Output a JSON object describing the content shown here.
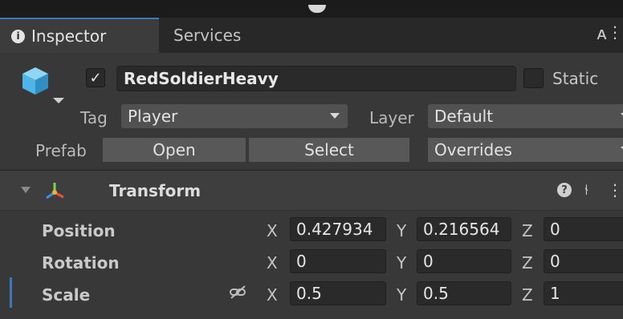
{
  "tabs": {
    "inspector": "Inspector",
    "services": "Services"
  },
  "object": {
    "active": true,
    "name": "RedSoldierHeavy",
    "static_label": "Static",
    "static_checked": false
  },
  "tag": {
    "label": "Tag",
    "value": "Player"
  },
  "layer": {
    "label": "Layer",
    "value": "Default"
  },
  "prefab": {
    "label": "Prefab",
    "open": "Open",
    "select": "Select",
    "overrides": "Overrides"
  },
  "transform": {
    "title": "Transform",
    "position": {
      "label": "Position",
      "x": "0.427934",
      "y": "0.216564",
      "z": "0"
    },
    "rotation": {
      "label": "Rotation",
      "x": "0",
      "y": "0",
      "z": "0"
    },
    "scale": {
      "label": "Scale",
      "x": "0.5",
      "y": "0.5",
      "z": "1"
    }
  },
  "axes": {
    "x": "X",
    "y": "Y",
    "z": "Z"
  },
  "icons": {
    "info": "info-icon",
    "lock": "lock-icon",
    "more": "more-icon",
    "cube": "gameobject-cube-icon",
    "transform": "transform-axes-icon",
    "help": "help-icon",
    "presets": "presets-icon",
    "link": "scale-link-icon"
  },
  "colors": {
    "accent": "#3a79bb",
    "panel": "#383838",
    "field": "#2a2a2a"
  }
}
